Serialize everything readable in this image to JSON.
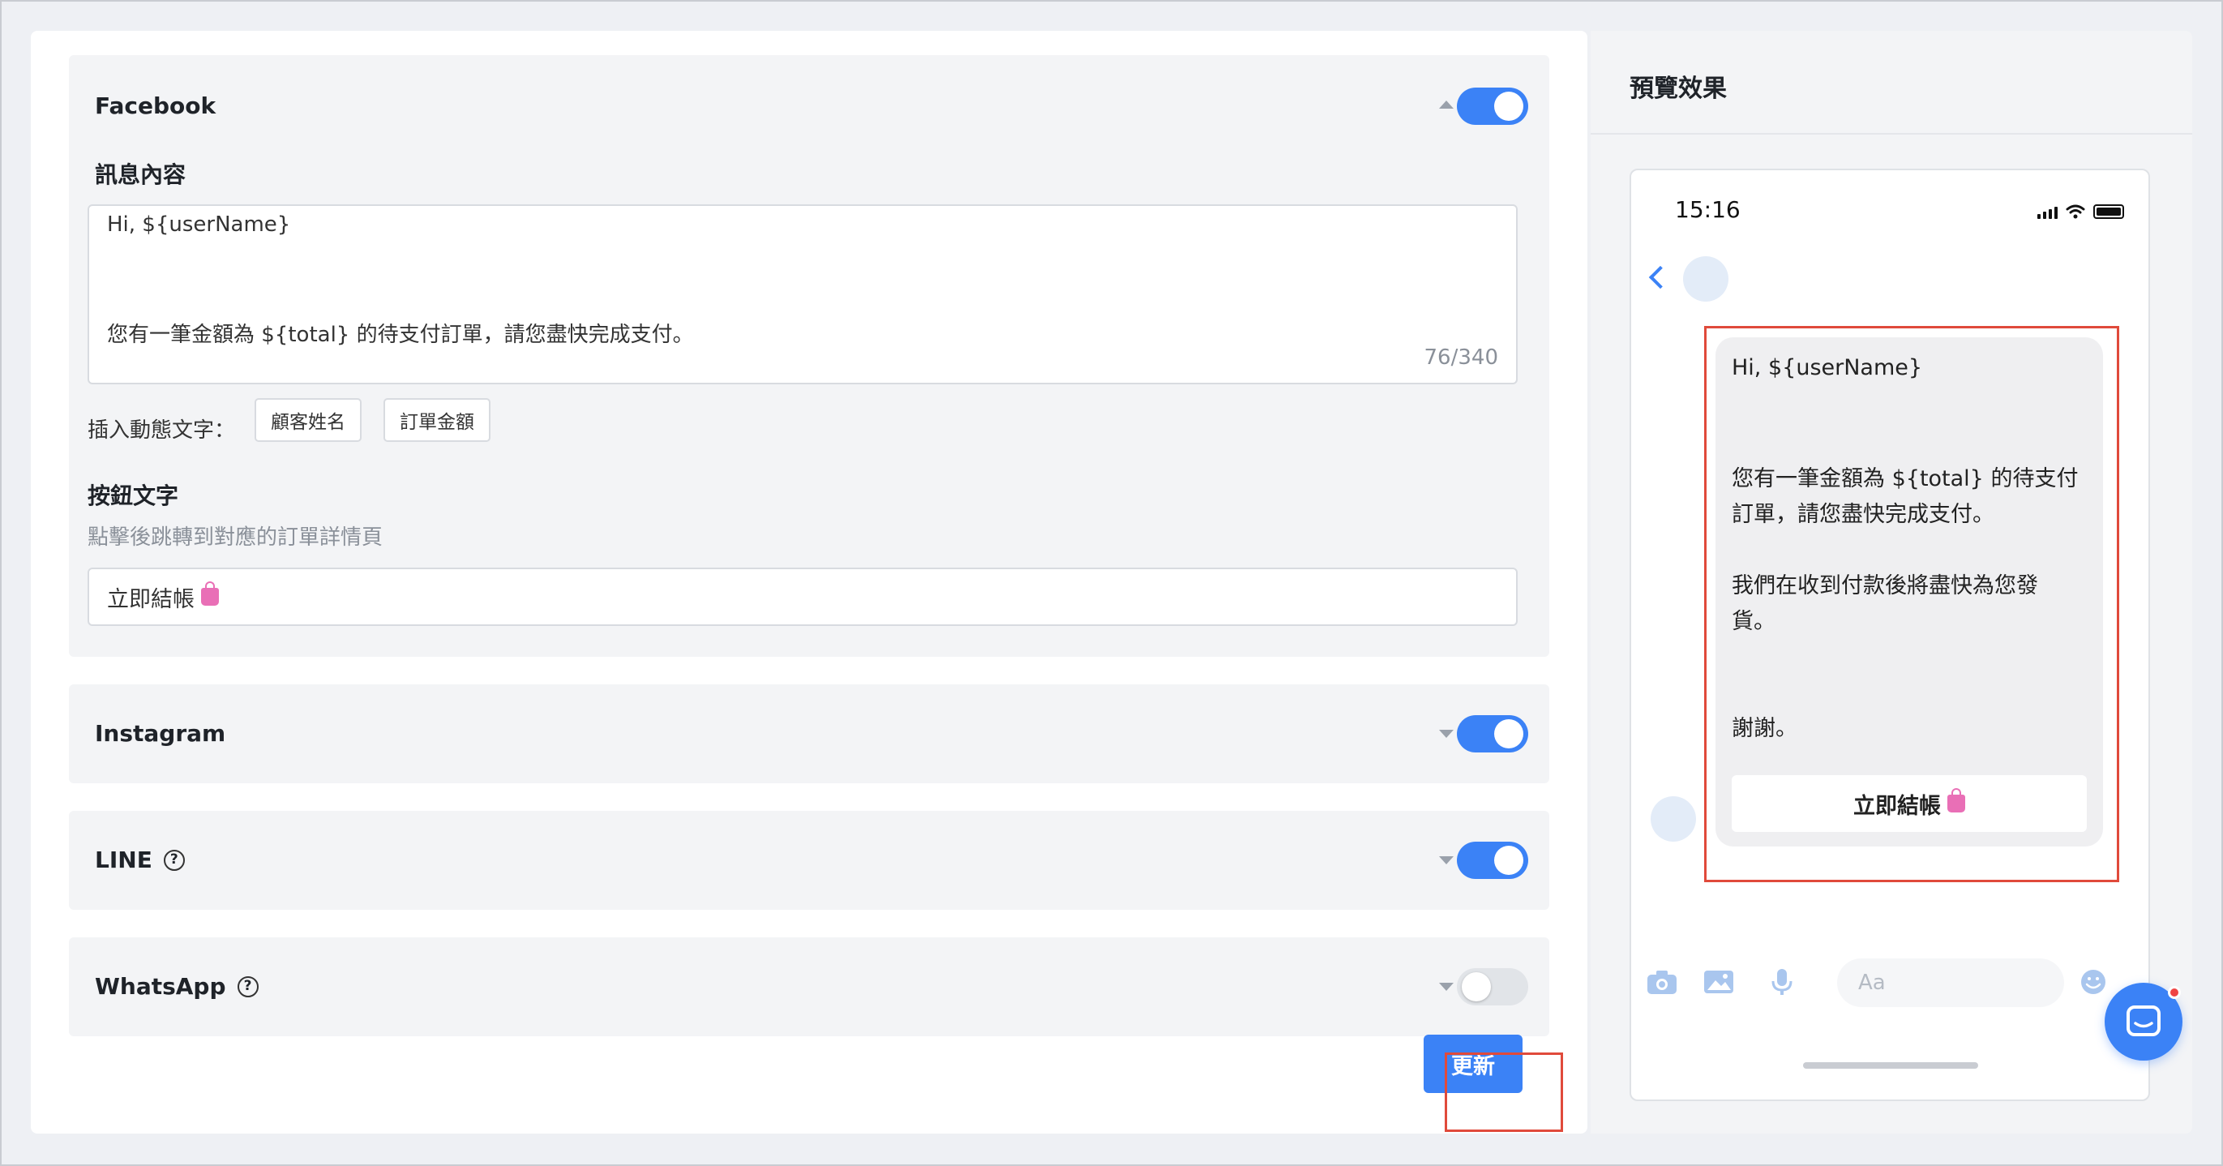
{
  "channels": {
    "facebook": {
      "name": "Facebook",
      "enabled": true,
      "expanded": true
    },
    "instagram": {
      "name": "Instagram",
      "enabled": true,
      "expanded": false
    },
    "line": {
      "name": "LINE",
      "enabled": true,
      "expanded": false
    },
    "whatsapp": {
      "name": "WhatsApp",
      "enabled": false,
      "expanded": false
    }
  },
  "message": {
    "label": "訊息內容",
    "line1": "Hi, ${userName}",
    "line2": "您有一筆金額為 ${total} 的待支付訂單，請您盡快完成支付。",
    "counter": "76/340",
    "insert_label": "插入動態文字：",
    "chips": [
      "顧客姓名",
      "訂單金額"
    ]
  },
  "button_text": {
    "label": "按鈕文字",
    "hint": "點擊後跳轉到對應的訂單詳情頁",
    "value": "立即結帳"
  },
  "update_label": "更新",
  "preview": {
    "title": "預覽效果",
    "time": "15:16",
    "bubble": {
      "line1": "Hi, ${userName}",
      "line2": "您有一筆金額為 ${total} 的待支付",
      "line3": "訂單，請您盡快完成支付。",
      "line4": "我們在收到付款後將盡快為您發",
      "line5": "貨。",
      "line6": "謝謝。",
      "button": "立即結帳"
    },
    "composer_placeholder": "Aa"
  },
  "colors": {
    "accent": "#3b82f6",
    "highlight_border": "#e04a3b",
    "toggle_off": "#e1e4e8"
  }
}
